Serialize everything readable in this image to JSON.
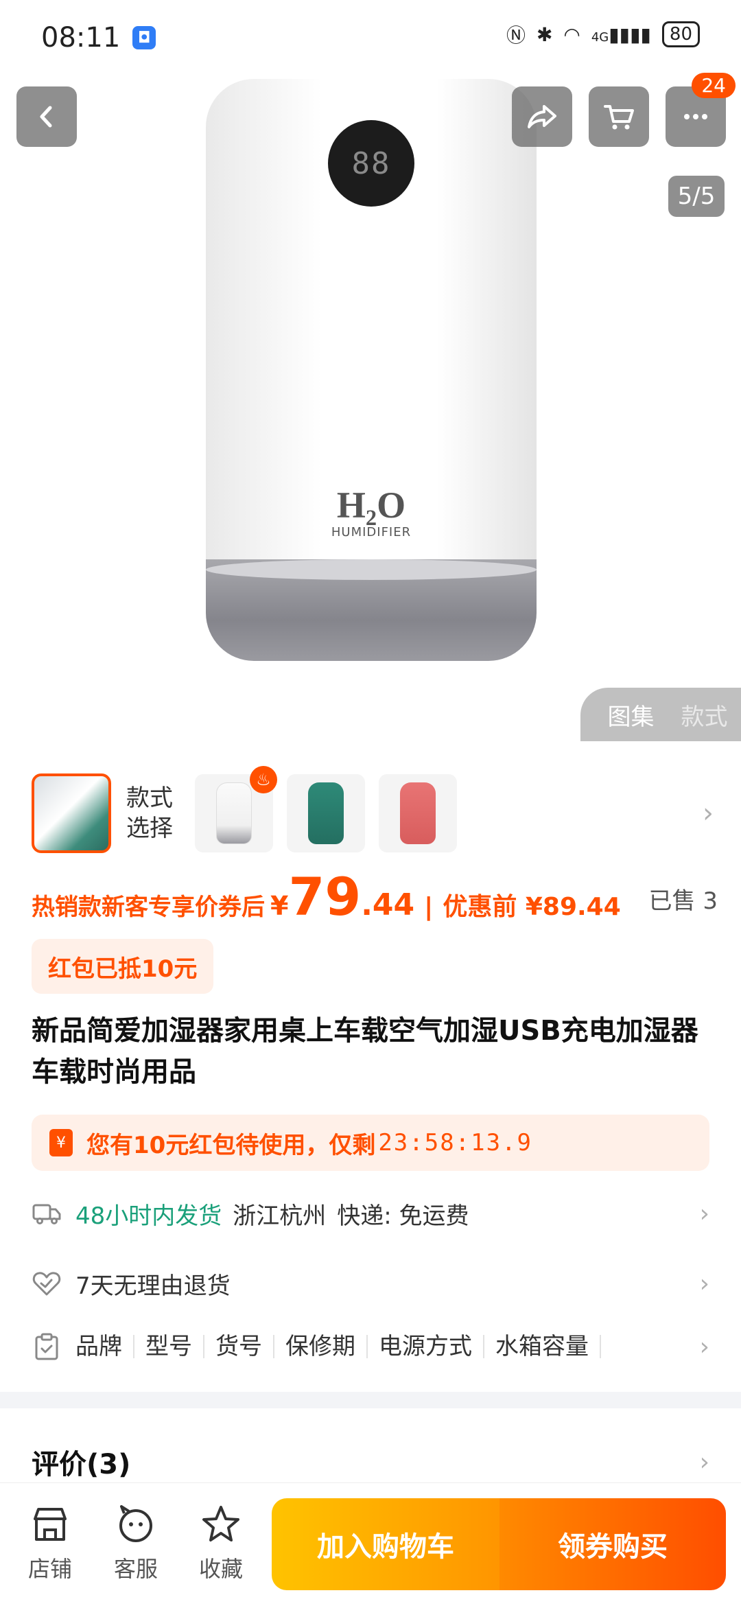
{
  "status_bar": {
    "time": "08:11",
    "battery": "80",
    "network": "4G"
  },
  "gallery": {
    "page_indicator": "5/5",
    "cart_count": "24",
    "tabs": [
      "图集",
      "款式"
    ],
    "product_display": "88",
    "product_logo": "H₂O",
    "product_logo_sub": "HUMIDIFIER"
  },
  "variants": {
    "label": "款式选择",
    "label_line1": "款式",
    "label_line2": "选择",
    "colors": [
      "#ffffff",
      "#2e8a78",
      "#e86a6a"
    ]
  },
  "price": {
    "prefix": "热销款新客专享价券后",
    "currency": "¥",
    "integer": "79",
    "decimal": ".44",
    "separator": "|",
    "original": "优惠前 ¥89.44",
    "sold": "已售 3"
  },
  "coupon_tag": "红包已抵10元",
  "title": "新品简爱加湿器家用桌上车载空气加湿USB充电加湿器车载时尚用品",
  "redpacket": {
    "icon": "¥",
    "text": "您有10元红包待使用，仅剩",
    "countdown": "23:58:13.9"
  },
  "shipping": {
    "highlight": "48小时内发货",
    "location": "浙江杭州",
    "method": "快递: 免运费"
  },
  "returns": "7天无理由退货",
  "params": [
    "品牌",
    "型号",
    "货号",
    "保修期",
    "电源方式",
    "水箱容量"
  ],
  "reviews": "评价(3)",
  "bottom_bar": {
    "shop": "店铺",
    "service": "客服",
    "favorite": "收藏",
    "add_to_cart": "加入购物车",
    "buy": "领券购买"
  },
  "colors": {
    "accent": "#ff5000",
    "green": "#1aa07a",
    "cta_cart": "#ffb300",
    "cta_buy": "#ff5a00"
  }
}
